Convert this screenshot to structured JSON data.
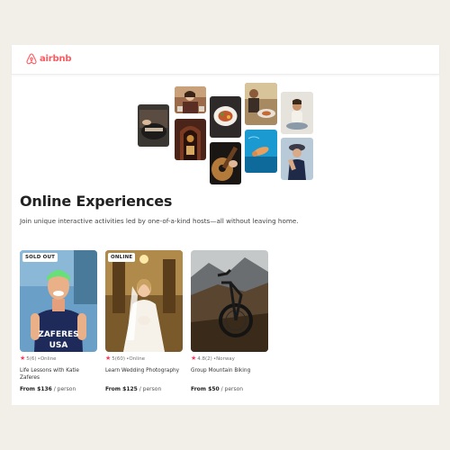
{
  "brand": {
    "name": "airbnb",
    "color": "#ff5a5f"
  },
  "page": {
    "title": "Online Experiences",
    "subtitle": "Join unique interactive activities led by one-of-a-kind hosts—all without leaving home."
  },
  "experiences": [
    {
      "badge": "SOLD OUT",
      "rating": "5(6)",
      "location": "•Online",
      "title": "Life Lessons with Katie Zaferes",
      "price_prefix": "From ",
      "price": "$136",
      "price_unit": " / person"
    },
    {
      "badge": "ONLINE",
      "rating": "5(60)",
      "location": "•Online",
      "title": "Learn Wedding Photography",
      "price_prefix": "From ",
      "price": "$125",
      "price_unit": " / person"
    },
    {
      "badge": "",
      "rating": "4.8(2)",
      "location": "•Norway",
      "title": "Group Mountain Biking",
      "price_prefix": "From ",
      "price": "$50",
      "price_unit": " / person"
    }
  ],
  "icons": {
    "star": "star-icon",
    "logo": "airbnb-logo-icon"
  }
}
